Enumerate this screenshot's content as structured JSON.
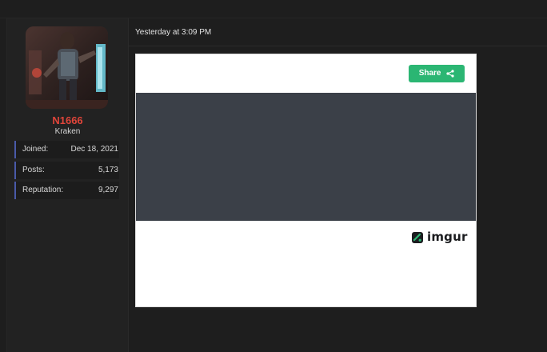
{
  "user": {
    "name": "N1666",
    "title": "Kraken",
    "stats": [
      {
        "label": "Joined:",
        "value": "Dec 18, 2021"
      },
      {
        "label": "Posts:",
        "value": "5,173"
      },
      {
        "label": "Reputation:",
        "value": "9,297"
      }
    ]
  },
  "post": {
    "timestamp": "Yesterday at 3:09 PM"
  },
  "embed": {
    "share_label": "Share",
    "provider": "imgur"
  },
  "colors": {
    "username": "#e0453a",
    "share_button": "#2bb673",
    "stat_accent": "#4a5aa8",
    "media_placeholder": "#3b4048"
  },
  "icons": {
    "share": "share-icon",
    "provider_logo": "imgur-logo-icon"
  }
}
